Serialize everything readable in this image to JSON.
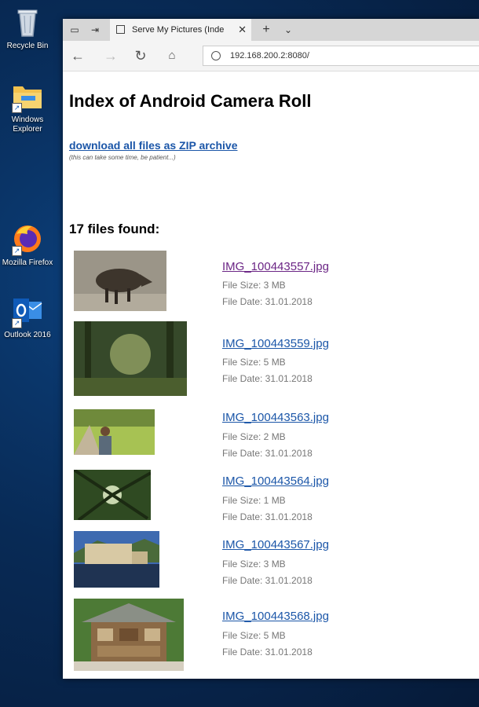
{
  "desktop": {
    "icons": [
      {
        "label": "Recycle Bin"
      },
      {
        "label": "Windows Explorer"
      },
      {
        "label": "Mozilla Firefox"
      },
      {
        "label": "Outlook 2016"
      }
    ]
  },
  "browser": {
    "tab_title": "Serve My Pictures (Inde",
    "url": "192.168.200.2:8080/"
  },
  "page": {
    "heading": "Index of Android Camera Roll",
    "zip_link": "download all files as ZIP archive",
    "zip_note": "(this can take some time, be patient...)",
    "files_found": "17 files found:",
    "files": [
      {
        "name": "IMG_100443557.jpg",
        "size": "File Size:  3 MB",
        "date": "File Date: 31.01.2018"
      },
      {
        "name": "IMG_100443559.jpg",
        "size": "File Size:  5 MB",
        "date": "File Date: 31.01.2018"
      },
      {
        "name": "IMG_100443563.jpg",
        "size": "File Size:  2 MB",
        "date": "File Date: 31.01.2018"
      },
      {
        "name": "IMG_100443564.jpg",
        "size": "File Size:  1 MB",
        "date": "File Date: 31.01.2018"
      },
      {
        "name": "IMG_100443567.jpg",
        "size": "File Size:  3 MB",
        "date": "File Date: 31.01.2018"
      },
      {
        "name": "IMG_100443568.jpg",
        "size": "File Size:  5 MB",
        "date": "File Date: 31.01.2018"
      }
    ]
  }
}
